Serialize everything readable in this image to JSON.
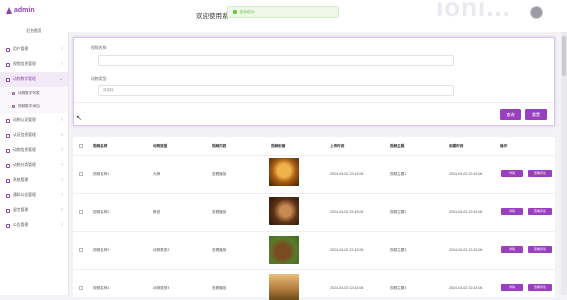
{
  "sidebar": {
    "logo": "admin",
    "home": "后台首页",
    "items": [
      {
        "label": "用户管理"
      },
      {
        "label": "视频信息管理"
      },
      {
        "label": "动物数字管理"
      },
      {
        "label": "动物认证管理"
      },
      {
        "label": "认证信息管理"
      },
      {
        "label": "动物信息管理"
      },
      {
        "label": "动物分类管理"
      },
      {
        "label": "系统管理"
      },
      {
        "label": "通知公告管理"
      },
      {
        "label": "留言管理"
      },
      {
        "label": "公告管理"
      }
    ],
    "submenu": [
      "动物数字列表",
      "视频数字添加"
    ]
  },
  "header": {
    "welcome": "欢迎使用系",
    "toast": "查询成功!",
    "watermark": "ioni..."
  },
  "search": {
    "label1": "视频名称:",
    "placeholder1": "",
    "label2": "动物类型:",
    "placeholder2": "请选择",
    "query_btn": "查询",
    "reset_btn": "重置"
  },
  "table": {
    "headers": [
      "视频名称",
      "动物类型",
      "视频内容",
      "视频封面",
      "上传时间",
      "视频主题",
      "到期时间",
      "操作"
    ],
    "rows": [
      {
        "name": "视频名称1",
        "type": "大狮",
        "content": "查看播放",
        "upload": "2024-04-02 22:43:06",
        "topic": "视频主题1",
        "expire": "2024-04-02 22:43:06"
      },
      {
        "name": "视频名称2",
        "type": "豚鼠",
        "content": "查看播放",
        "upload": "2024-04-02 22:43:06",
        "topic": "视频主题2",
        "expire": "2024-04-02 22:43:06"
      },
      {
        "name": "视频名称3",
        "type": "动物类型3",
        "content": "查看播放",
        "upload": "2024-04-02 22:43:06",
        "topic": "视频主题3",
        "expire": "2024-04-02 22:43:06"
      },
      {
        "name": "视频名称4",
        "type": "动物类型4",
        "content": "查看播放",
        "upload": "2024-04-02 22:43:06",
        "topic": "视频主题4",
        "expire": "2024-04-02 22:43:06"
      }
    ],
    "action1": "详情",
    "action2": "查看评论"
  },
  "colors": {
    "accent": "#9b3fc1",
    "brand": "#8e44ad",
    "success": "#67c23a"
  }
}
